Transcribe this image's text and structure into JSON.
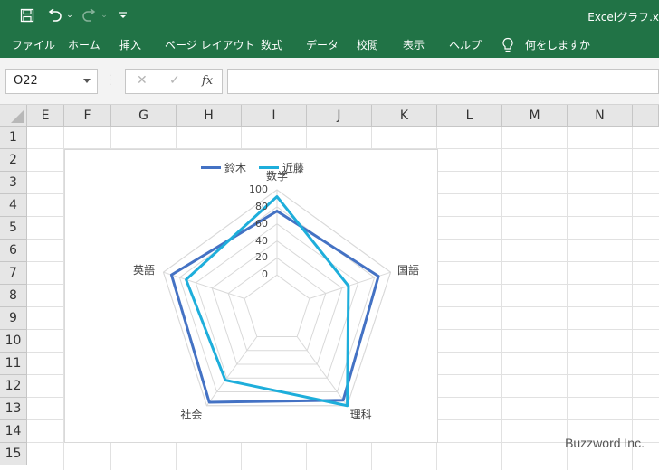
{
  "window": {
    "title": "Excelグラフ.x"
  },
  "ribbon": {
    "tabs": [
      "ファイル",
      "ホーム",
      "挿入",
      "ページ レイアウト",
      "数式",
      "データ",
      "校閲",
      "表示",
      "ヘルプ"
    ],
    "tell_me": "何をしますか"
  },
  "formula_bar": {
    "name_box": "O22",
    "fx": "fx",
    "value": ""
  },
  "sheet": {
    "columns": [
      "E",
      "F",
      "G",
      "H",
      "I",
      "J",
      "K",
      "L",
      "M",
      "N"
    ],
    "rows": [
      "1",
      "2",
      "3",
      "4",
      "5",
      "6",
      "7",
      "8",
      "9",
      "10",
      "11",
      "12",
      "13",
      "14",
      "15"
    ]
  },
  "chart_data": {
    "type": "radar",
    "categories": [
      "数学",
      "国語",
      "理科",
      "社会",
      "英語"
    ],
    "series": [
      {
        "name": "鈴木",
        "values": [
          75,
          85,
          92,
          95,
          90
        ],
        "color": "#4472C4"
      },
      {
        "name": "近藤",
        "values": [
          92,
          48,
          100,
          63,
          72
        ],
        "color": "#1EAEDB"
      }
    ],
    "ticks": [
      "0",
      "20",
      "40",
      "60",
      "80",
      "100"
    ],
    "rmin": -40,
    "rmax": 100,
    "legend_position": "top",
    "grid": true
  },
  "watermark": "Buzzword Inc."
}
